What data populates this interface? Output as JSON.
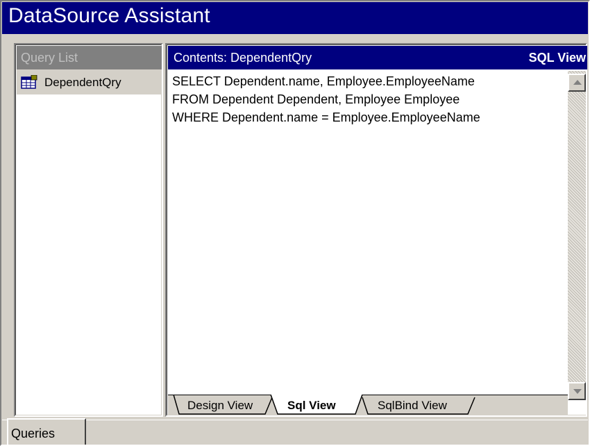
{
  "window": {
    "title": "DataSource Assistant"
  },
  "query_list": {
    "header": "Query List",
    "items": [
      {
        "label": "DependentQry",
        "icon": "query-grid-icon"
      }
    ]
  },
  "contents": {
    "title": "Contents: DependentQry",
    "view_label": "SQL View",
    "sql_lines": [
      "SELECT Dependent.name, Employee.EmployeeName",
      "FROM Dependent Dependent, Employee Employee",
      "WHERE Dependent.name = Employee.EmployeeName"
    ]
  },
  "view_tabs": [
    {
      "label": "Design View",
      "active": false
    },
    {
      "label": "Sql View",
      "active": true
    },
    {
      "label": "SqlBind View",
      "active": false
    }
  ],
  "bottom_tabs": [
    {
      "label": "Queries",
      "active": true
    }
  ],
  "colors": {
    "titlebar": "#00007f",
    "face": "#d4d0c8",
    "header_gray": "#808080",
    "text_white": "#ffffff"
  }
}
